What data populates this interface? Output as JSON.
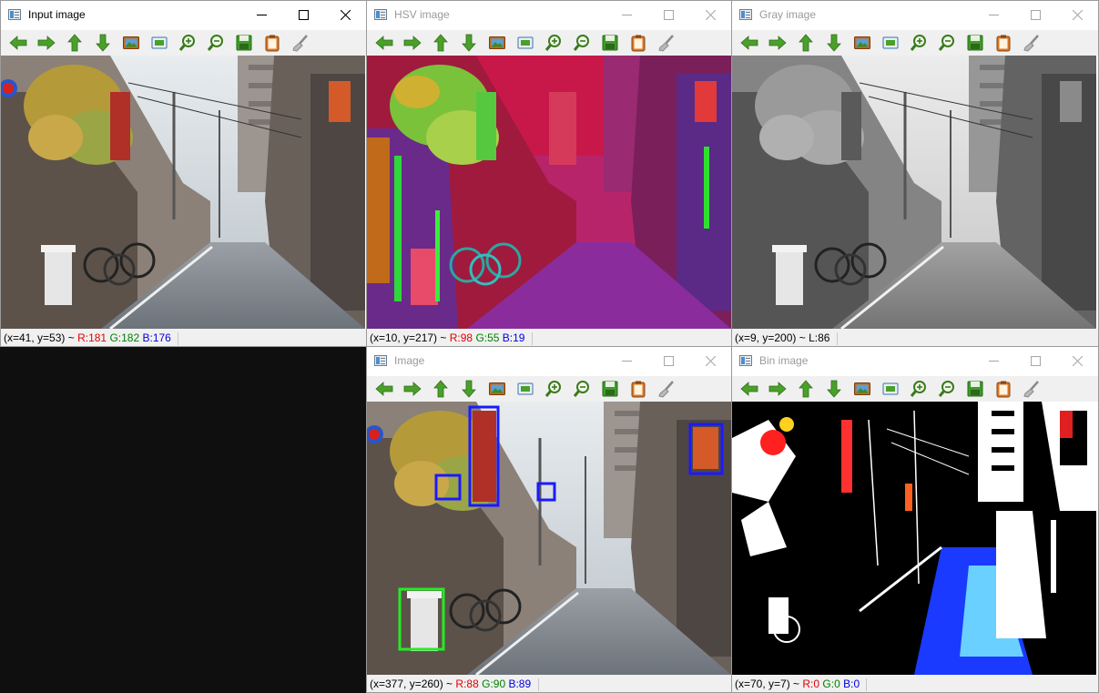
{
  "windows": [
    {
      "id": "input",
      "title": "Input image",
      "active": true,
      "status": {
        "coords": "(x=41, y=53) ~",
        "r": "R:181",
        "g": "G:182",
        "b": "B:176"
      }
    },
    {
      "id": "hsv",
      "title": "HSV image",
      "active": false,
      "status": {
        "coords": "(x=10, y=217) ~",
        "r": "R:98",
        "g": "G:55",
        "b": "B:19"
      }
    },
    {
      "id": "gray",
      "title": "Gray image",
      "active": false,
      "status": {
        "coords": "(x=9, y=200) ~",
        "l": "L:86"
      }
    },
    {
      "id": "image",
      "title": "Image",
      "active": false,
      "status": {
        "coords": "(x=377, y=260) ~",
        "r": "R:88",
        "g": "G:90",
        "b": "B:89"
      }
    },
    {
      "id": "bin",
      "title": "Bin image",
      "active": false,
      "status": {
        "coords": "(x=70, y=7) ~",
        "r": "R:0",
        "g": "G:0",
        "b": "B:0"
      }
    }
  ],
  "toolbar_icons": [
    "arrow-left-icon",
    "arrow-right-icon",
    "arrow-up-icon",
    "arrow-down-icon",
    "image-icon",
    "fit-window-icon",
    "zoom-in-icon",
    "zoom-out-icon",
    "save-icon",
    "clipboard-icon",
    "brush-icon"
  ],
  "detections": {
    "blue_boxes": 4,
    "green_boxes": 1,
    "colors": {
      "blue": "#1a1aff",
      "green": "#22ee22"
    }
  },
  "colors": {
    "desktop": "#0f0f0f",
    "toolbar_bg": "#f0f0f0",
    "status_red": "#e00000",
    "status_green": "#008000",
    "status_blue": "#0000e0"
  }
}
